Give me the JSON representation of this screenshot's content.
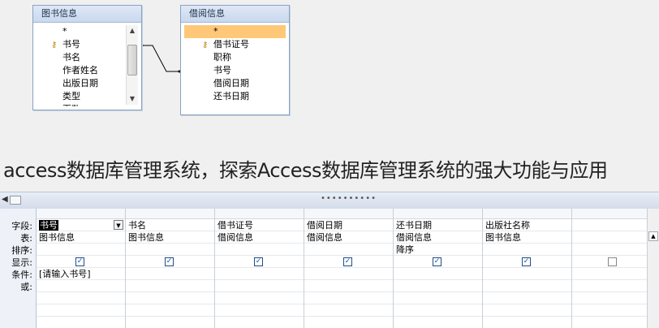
{
  "tables": [
    {
      "title": "图书信息",
      "fields": [
        "*",
        "书号",
        "书名",
        "作者姓名",
        "出版日期",
        "类型",
        "页数"
      ],
      "key_field": "书号"
    },
    {
      "title": "借阅信息",
      "fields": [
        "*",
        "借书证号",
        "职称",
        "书号",
        "借阅日期",
        "还书日期"
      ],
      "key_field": "借书证号",
      "selected_field": "*"
    }
  ],
  "caption": "access数据库管理系统，探索Access数据库管理系统的强大功能与应用",
  "grid": {
    "row_labels": [
      "字段:",
      "表:",
      "排序:",
      "显示:",
      "条件:",
      "或:"
    ],
    "columns": [
      {
        "field": "书号",
        "table": "图书信息",
        "sort": "",
        "show": true,
        "criteria": "[请输入书号]"
      },
      {
        "field": "书名",
        "table": "图书信息",
        "sort": "",
        "show": true,
        "criteria": ""
      },
      {
        "field": "借书证号",
        "table": "借阅信息",
        "sort": "",
        "show": true,
        "criteria": ""
      },
      {
        "field": "借阅日期",
        "table": "借阅信息",
        "sort": "",
        "show": true,
        "criteria": ""
      },
      {
        "field": "还书日期",
        "table": "借阅信息",
        "sort": "降序",
        "show": true,
        "criteria": ""
      },
      {
        "field": "出版社名称",
        "table": "图书信息",
        "sort": "",
        "show": true,
        "criteria": ""
      },
      {
        "field": "",
        "table": "",
        "sort": "",
        "show": false,
        "criteria": ""
      }
    ]
  },
  "icons": {
    "key": "key-icon",
    "dropdown": "chevron-down-icon",
    "check": "check-icon"
  }
}
